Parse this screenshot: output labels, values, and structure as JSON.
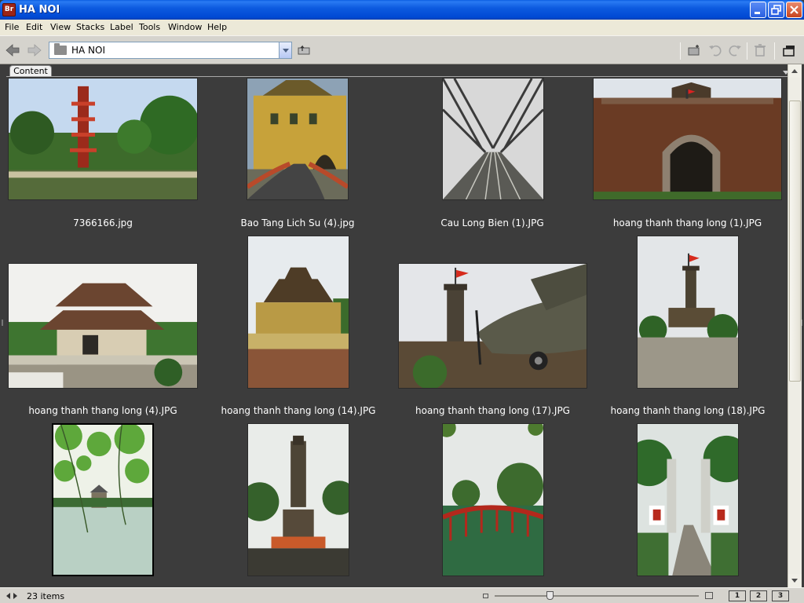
{
  "window": {
    "title": "HA NOI",
    "app_icon_text": "Br"
  },
  "menu": [
    "File",
    "Edit",
    "View",
    "Stacks",
    "Label",
    "Tools",
    "Window",
    "Help"
  ],
  "path": {
    "current": "HA NOI"
  },
  "panel": {
    "tab_label": "Content"
  },
  "items": [
    {
      "caption": "7366166.jpg",
      "scene": "pagoda"
    },
    {
      "caption": "Bao Tang Lich Su (4).jpg",
      "scene": "museum"
    },
    {
      "caption": "Cau Long Bien (1).JPG",
      "scene": "bridge"
    },
    {
      "caption": "hoang thanh thang long (1).JPG",
      "scene": "gate"
    },
    {
      "caption": "hoang thanh thang long (4).JPG",
      "scene": "pavilion"
    },
    {
      "caption": "hoang thanh thang long (14).JPG",
      "scene": "hall"
    },
    {
      "caption": "hoang thanh thang long (17).JPG",
      "scene": "plane"
    },
    {
      "caption": "hoang thanh thang long (18).JPG",
      "scene": "flagtower"
    },
    {
      "caption": "",
      "scene": "lake"
    },
    {
      "caption": "",
      "scene": "statue"
    },
    {
      "caption": "",
      "scene": "redbridge"
    },
    {
      "caption": "",
      "scene": "gatepath"
    }
  ],
  "status": {
    "count_text": "23 items",
    "zoom_level": 0.27
  },
  "view_buttons": [
    "1",
    "2",
    "3"
  ]
}
